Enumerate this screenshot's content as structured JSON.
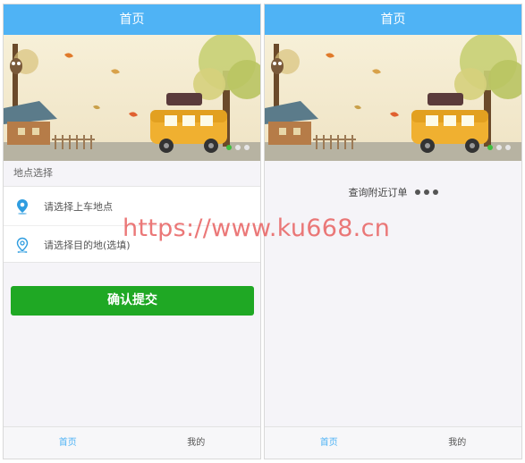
{
  "screens": {
    "form": {
      "title": "首页",
      "section_label": "地点选择",
      "pickup_placeholder": "请选择上车地点",
      "destination_placeholder": "请选择目的地(选填)",
      "submit_label": "确认提交",
      "tabs": [
        "首页",
        "我的"
      ],
      "active_tab": "首页"
    },
    "searching": {
      "title": "首页",
      "status_text": "查询附近订单",
      "tabs": [
        "首页",
        "我的"
      ],
      "active_tab": "首页"
    }
  },
  "watermark": "https://www.ku668.cn",
  "colors": {
    "header": "#4fb3f5",
    "primary_button": "#1fa824",
    "active_tab": "#4fb3f5",
    "icon": "#2f9de0",
    "watermark": "#e86060"
  },
  "icons": {
    "pickup": "location-pin-icon",
    "destination": "location-pin-outline-icon"
  },
  "carousel": {
    "slides": 3,
    "active": 1
  }
}
